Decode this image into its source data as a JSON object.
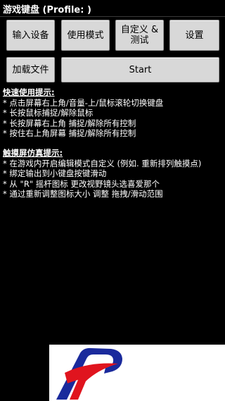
{
  "window": {
    "title": "游戏键盘 (Profile: )"
  },
  "toolbar": {
    "input_device": "输入设备",
    "usage_mode": "使用模式",
    "customize_line1": "自定义 &",
    "customize_line2": "测试",
    "settings": "设置",
    "load_file": "加载文件",
    "start": "Start"
  },
  "quick_tips": {
    "heading": "快速使用提示:",
    "lines": [
      "* 点击屏幕右上角/音量-上/鼠标滚轮切换键盘",
      "* 长按鼠标捕捉/解除鼠标",
      "* 长按屏幕右上角 捕捉/解除所有控制",
      "* 按住右上角屏幕 捕捉/解除所有控制"
    ]
  },
  "touch_tips": {
    "heading": "触摸屏仿真提示:",
    "lines": [
      "* 在游戏内开启编辑模式自定义 (例如. 重新排列触摸点)",
      "* 绑定输出到小键盘按键滑动",
      "* 从 \"R\" 摇杆图标 更改视野镜头选喜爱那个",
      "* 通过重新调整图标大小 调整 拖拽/滑动范围"
    ]
  },
  "watermark": {
    "icon": "stylized-p-logo-icon",
    "colors": {
      "blue": "#1a2a9c",
      "red": "#e0141e"
    }
  }
}
